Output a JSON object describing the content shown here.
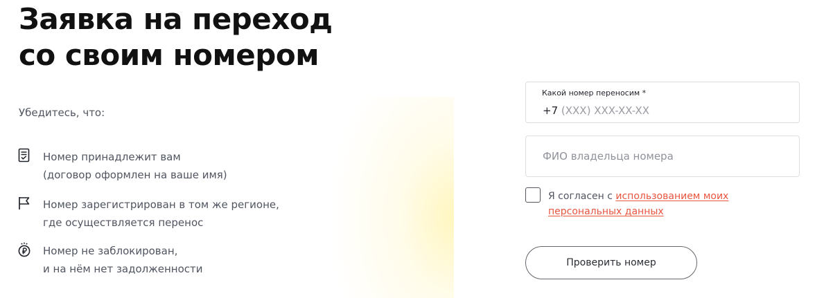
{
  "page": {
    "title_line1": "Заявка на переход",
    "title_line2": "со своим номером",
    "intro": "Убедитесь, что:"
  },
  "conditions": [
    {
      "icon": "document-icon",
      "line1": "Номер принадлежит вам",
      "line2": "(договор оформлен на ваше имя)"
    },
    {
      "icon": "flag-icon",
      "line1": "Номер зарегистрирован в том же регионе,",
      "line2": "где осуществляется перенос"
    },
    {
      "icon": "ruble-coin-icon",
      "line1": "Номер не заблокирован,",
      "line2": "и на нём нет задолженности"
    }
  ],
  "form": {
    "phone_label": "Какой номер переносим *",
    "phone_prefix": "+7",
    "phone_placeholder": "(XXX) XXX-XX-XX",
    "name_placeholder": "ФИО владельца номера",
    "consent_text": "Я согласен с ",
    "consent_link": "использованием моих персональных данных",
    "consent_checked": false,
    "submit_label": "Проверить номер"
  },
  "colors": {
    "link": "#e8553f",
    "text": "#505560",
    "heading": "#111111"
  }
}
